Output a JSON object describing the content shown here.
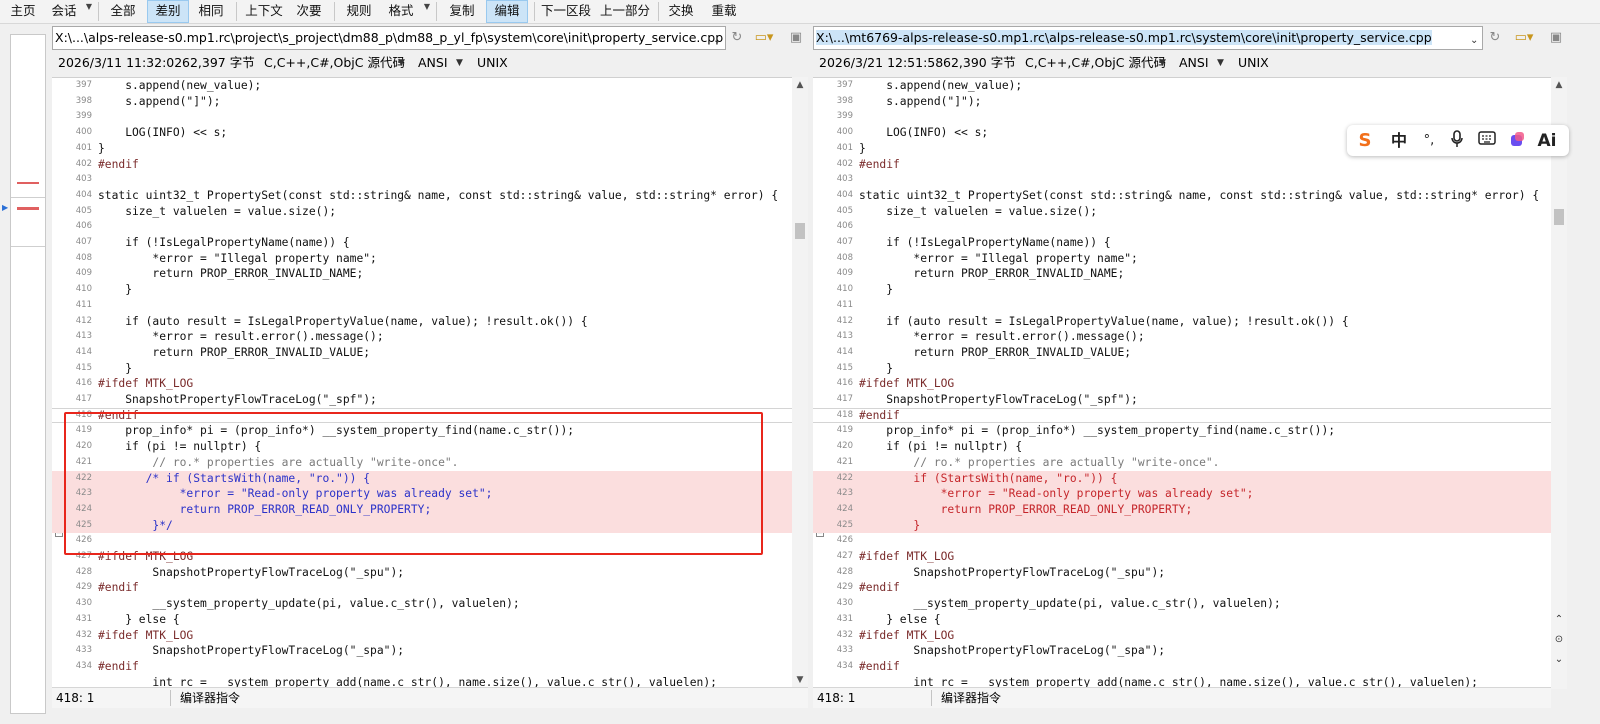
{
  "toolbar": {
    "items": [
      "主页",
      "会话",
      "全部",
      "差别",
      "相同",
      "上下文",
      "次要",
      "规则",
      "格式",
      "复制",
      "编辑",
      "下一区段",
      "上一部分",
      "交换",
      "重载"
    ]
  },
  "overview": {},
  "left": {
    "path": "X:\\...\\alps-release-s0.mp1.rc\\project\\s_project\\dm88_p\\dm88_p_yl_fp\\system\\core\\init\\property_service.cpp",
    "datetime": "2026/3/11 11:32:02",
    "size": "62,397 字节",
    "format": "C,C++,C#,ObjC 源代码",
    "encoding": "ANSI",
    "lineend": "UNIX",
    "cursor": "418: 1",
    "mode": "编译器指令",
    "lines": [
      {
        "n": "397",
        "t": "    s.append(new_value);"
      },
      {
        "n": "398",
        "t": "    s.append(\"]\");"
      },
      {
        "n": "399",
        "t": ""
      },
      {
        "n": "400",
        "t": "    LOG(INFO) << s;"
      },
      {
        "n": "401",
        "t": "}"
      },
      {
        "n": "402",
        "t": "#endif"
      },
      {
        "n": "403",
        "t": ""
      },
      {
        "n": "404",
        "t": "static uint32_t PropertySet(const std::string& name, const std::string& value, std::string* error) {"
      },
      {
        "n": "405",
        "t": "    size_t valuelen = value.size();"
      },
      {
        "n": "406",
        "t": ""
      },
      {
        "n": "407",
        "t": "    if (!IsLegalPropertyName(name)) {"
      },
      {
        "n": "408",
        "t": "        *error = \"Illegal property name\";"
      },
      {
        "n": "409",
        "t": "        return PROP_ERROR_INVALID_NAME;"
      },
      {
        "n": "410",
        "t": "    }"
      },
      {
        "n": "411",
        "t": ""
      },
      {
        "n": "412",
        "t": "    if (auto result = IsLegalPropertyValue(name, value); !result.ok()) {"
      },
      {
        "n": "413",
        "t": "        *error = result.error().message();"
      },
      {
        "n": "414",
        "t": "        return PROP_ERROR_INVALID_VALUE;"
      },
      {
        "n": "415",
        "t": "    }"
      },
      {
        "n": "416",
        "t": "#ifdef MTK_LOG"
      },
      {
        "n": "417",
        "t": "    SnapshotPropertyFlowTraceLog(\"_spf\");"
      },
      {
        "n": "418",
        "t": "#endif"
      },
      {
        "n": "419",
        "t": "    prop_info* pi = (prop_info*) __system_property_find(name.c_str());"
      },
      {
        "n": "420",
        "t": "    if (pi != nullptr) {"
      },
      {
        "n": "421",
        "t": "        // ro.* properties are actually \"write-once\"."
      },
      {
        "n": "422",
        "t": "       /* if (StartsWith(name, \"ro.\")) {"
      },
      {
        "n": "423",
        "t": "            *error = \"Read-only property was already set\";"
      },
      {
        "n": "424",
        "t": "            return PROP_ERROR_READ_ONLY_PROPERTY;"
      },
      {
        "n": "425",
        "t": "        }*/"
      },
      {
        "n": "426",
        "t": ""
      },
      {
        "n": "427",
        "t": "#ifdef MTK_LOG"
      },
      {
        "n": "428",
        "t": "        SnapshotPropertyFlowTraceLog(\"_spu\");"
      },
      {
        "n": "429",
        "t": "#endif"
      },
      {
        "n": "430",
        "t": "        __system_property_update(pi, value.c_str(), valuelen);"
      },
      {
        "n": "431",
        "t": "    } else {"
      },
      {
        "n": "432",
        "t": "#ifdef MTK_LOG"
      },
      {
        "n": "433",
        "t": "        SnapshotPropertyFlowTraceLog(\"_spa\");"
      },
      {
        "n": "434",
        "t": "#endif"
      },
      {
        "n": "",
        "t": "        int rc = __system_property_add(name.c_str(), name.size(), value.c_str(), valuelen);"
      }
    ]
  },
  "right": {
    "path": "X:\\...\\mt6769-alps-release-s0.mp1.rc\\alps-release-s0.mp1.rc\\system\\core\\init\\property_service.cpp",
    "datetime": "2026/3/21 12:51:58",
    "size": "62,390 字节",
    "format": "C,C++,C#,ObjC 源代码",
    "encoding": "ANSI",
    "lineend": "UNIX",
    "cursor": "418: 1",
    "mode": "编译器指令",
    "lines": [
      {
        "n": "397",
        "t": "    s.append(new_value);"
      },
      {
        "n": "398",
        "t": "    s.append(\"]\");"
      },
      {
        "n": "399",
        "t": ""
      },
      {
        "n": "400",
        "t": "    LOG(INFO) << s;"
      },
      {
        "n": "401",
        "t": "}"
      },
      {
        "n": "402",
        "t": "#endif"
      },
      {
        "n": "403",
        "t": ""
      },
      {
        "n": "404",
        "t": "static uint32_t PropertySet(const std::string& name, const std::string& value, std::string* error) {"
      },
      {
        "n": "405",
        "t": "    size_t valuelen = value.size();"
      },
      {
        "n": "406",
        "t": ""
      },
      {
        "n": "407",
        "t": "    if (!IsLegalPropertyName(name)) {"
      },
      {
        "n": "408",
        "t": "        *error = \"Illegal property name\";"
      },
      {
        "n": "409",
        "t": "        return PROP_ERROR_INVALID_NAME;"
      },
      {
        "n": "410",
        "t": "    }"
      },
      {
        "n": "411",
        "t": ""
      },
      {
        "n": "412",
        "t": "    if (auto result = IsLegalPropertyValue(name, value); !result.ok()) {"
      },
      {
        "n": "413",
        "t": "        *error = result.error().message();"
      },
      {
        "n": "414",
        "t": "        return PROP_ERROR_INVALID_VALUE;"
      },
      {
        "n": "415",
        "t": "    }"
      },
      {
        "n": "416",
        "t": "#ifdef MTK_LOG"
      },
      {
        "n": "417",
        "t": "    SnapshotPropertyFlowTraceLog(\"_spf\");"
      },
      {
        "n": "418",
        "t": "#endif"
      },
      {
        "n": "419",
        "t": "    prop_info* pi = (prop_info*) __system_property_find(name.c_str());"
      },
      {
        "n": "420",
        "t": "    if (pi != nullptr) {"
      },
      {
        "n": "421",
        "t": "        // ro.* properties are actually \"write-once\"."
      },
      {
        "n": "422",
        "t": "        if (StartsWith(name, \"ro.\")) {"
      },
      {
        "n": "423",
        "t": "            *error = \"Read-only property was already set\";"
      },
      {
        "n": "424",
        "t": "            return PROP_ERROR_READ_ONLY_PROPERTY;"
      },
      {
        "n": "425",
        "t": "        }"
      },
      {
        "n": "426",
        "t": ""
      },
      {
        "n": "427",
        "t": "#ifdef MTK_LOG"
      },
      {
        "n": "428",
        "t": "        SnapshotPropertyFlowTraceLog(\"_spu\");"
      },
      {
        "n": "429",
        "t": "#endif"
      },
      {
        "n": "430",
        "t": "        __system_property_update(pi, value.c_str(), valuelen);"
      },
      {
        "n": "431",
        "t": "    } else {"
      },
      {
        "n": "432",
        "t": "#ifdef MTK_LOG"
      },
      {
        "n": "433",
        "t": "        SnapshotPropertyFlowTraceLog(\"_spa\");"
      },
      {
        "n": "434",
        "t": "#endif"
      },
      {
        "n": "",
        "t": "        int rc = __system_property_add(name.c_str(), name.size(), value.c_str(), valuelen);"
      }
    ]
  },
  "ime": {
    "items": [
      "S",
      "中",
      "°,",
      "mic-icon",
      "keyboard-icon",
      "skin-icon",
      "Ai"
    ]
  },
  "colors": {
    "diff_bg": "#fbdede",
    "diff_removed_text": "#2b32c9",
    "diff_added_text": "#c5262b",
    "annotation_box": "#e8261c",
    "active_toolbar": "#cce4f7"
  }
}
